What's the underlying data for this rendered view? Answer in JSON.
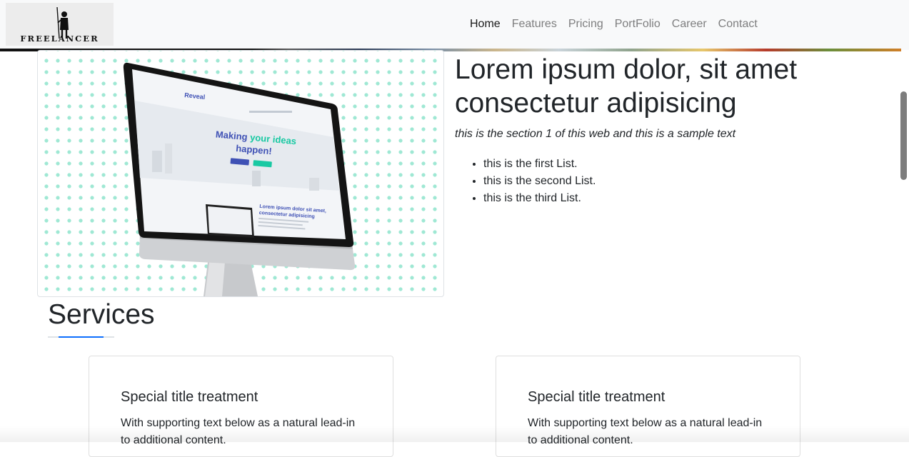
{
  "brand": {
    "name": "FREELANCER"
  },
  "nav": {
    "items": [
      {
        "label": "Home",
        "active": true
      },
      {
        "label": "Features",
        "active": false
      },
      {
        "label": "Pricing",
        "active": false
      },
      {
        "label": "PortFolio",
        "active": false
      },
      {
        "label": "Career",
        "active": false
      },
      {
        "label": "Contact",
        "active": false
      }
    ]
  },
  "section1": {
    "headline": "Lorem ipsum dolor, sit amet consectetur adipisicing",
    "subtitle": "this is the section 1 of this web and this is a sample text",
    "list": [
      "this is the first List.",
      "this is the second List.",
      "this is the third List."
    ],
    "mockup": {
      "site_name": "Reveal",
      "hero_line1": "Making ",
      "hero_highlight": "your ideas",
      "hero_line2": "happen!",
      "section_title_1": "Lorem ipsum dolor sit amet,",
      "section_title_2": "consectetur adipisicing"
    }
  },
  "services": {
    "title": "Services",
    "cards": [
      {
        "title": "Special title treatment",
        "text": "With supporting text below as a natural lead-in to additional content."
      },
      {
        "title": "Special title treatment",
        "text": "With supporting text below as a natural lead-in to additional content."
      }
    ]
  },
  "colors": {
    "accent": "#0d6efd",
    "dots": "#9fe8d4",
    "mockup_title": "#3f51b5",
    "mockup_highlight": "#19c9a3"
  }
}
